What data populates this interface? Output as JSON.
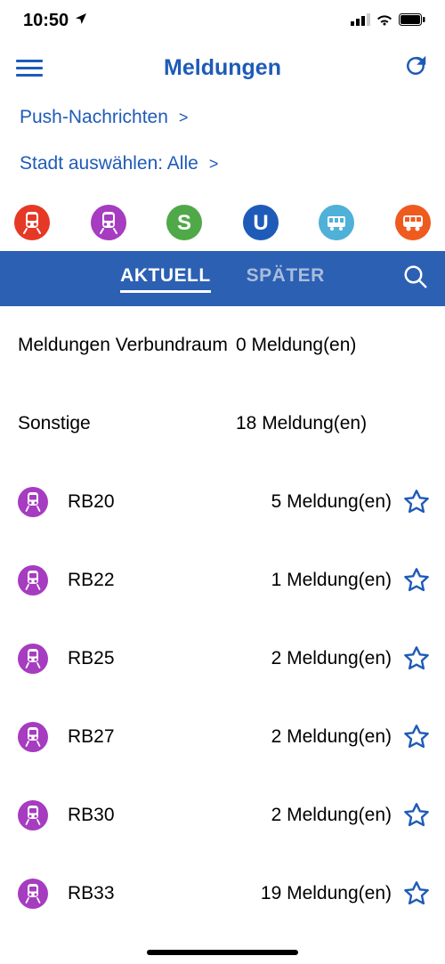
{
  "status": {
    "time": "10:50"
  },
  "nav": {
    "title": "Meldungen"
  },
  "links": {
    "push": "Push-Nachrichten",
    "city_label": "Stadt auswählen:",
    "city_value": "Alle"
  },
  "transport_chips": [
    {
      "name": "regional-train-icon",
      "color": "#e53926"
    },
    {
      "name": "train-icon",
      "color": "#a63cc0"
    },
    {
      "name": "sbahn-icon",
      "color": "#4fa948",
      "letter": "S"
    },
    {
      "name": "ubahn-icon",
      "color": "#1e5bb8",
      "letter": "U"
    },
    {
      "name": "tram-icon",
      "color": "#4fb0d8"
    },
    {
      "name": "bus-icon",
      "color": "#ef5a1f"
    }
  ],
  "tabs": {
    "active": "AKTUELL",
    "inactive": "SPÄTER"
  },
  "sections": [
    {
      "label": "Meldungen Verbundraum",
      "count": "0 Meldung(en)"
    },
    {
      "label": "Sonstige",
      "count": "18 Meldung(en)"
    }
  ],
  "lines": [
    {
      "name": "RB20",
      "count": "5 Meldung(en)"
    },
    {
      "name": "RB22",
      "count": "1 Meldung(en)"
    },
    {
      "name": "RB25",
      "count": "2 Meldung(en)"
    },
    {
      "name": "RB27",
      "count": "2 Meldung(en)"
    },
    {
      "name": "RB30",
      "count": "2 Meldung(en)"
    },
    {
      "name": "RB33",
      "count": "19 Meldung(en)"
    }
  ]
}
